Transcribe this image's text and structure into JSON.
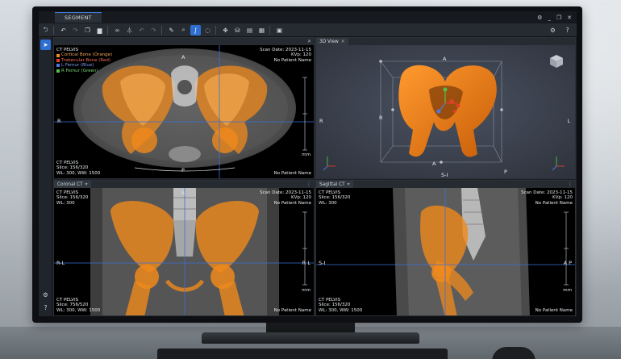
{
  "app": {
    "tab_label": "SEGMENT",
    "window_controls": [
      "⚙",
      "_",
      "❐",
      "✕"
    ]
  },
  "toolbar": {
    "icons": [
      "undo-icon",
      "undo-step-icon",
      "redo-step-icon",
      "copy-icon",
      "delete-icon",
      "link-icon",
      "filter-icon",
      "undo-dim-icon",
      "redo-dim-icon",
      "brush-icon",
      "zoom-icon",
      "draw-curve-icon",
      "lasso-icon",
      "move-icon",
      "threshold-icon",
      "grid-icon",
      "export-icon"
    ],
    "right_icons": [
      "gear-icon",
      "help-icon"
    ]
  },
  "viewports": {
    "axial": {
      "title": "",
      "top_left": [
        "CT PELVIS"
      ],
      "legend": [
        {
          "label": "Cortical Bone (Orange)",
          "color": "#f08a1c"
        },
        {
          "label": "Trabecular Bone (Red)",
          "color": "#e0402a"
        },
        {
          "label": "L Femur (Blue)",
          "color": "#4a78e8"
        },
        {
          "label": "R Femur (Green)",
          "color": "#4fc24f"
        }
      ],
      "top_right": [
        "Scan Date: 2023-11-15",
        "KVp: 120",
        "No Patient Name"
      ],
      "bottom_left": [
        "CT PELVIS",
        "Slice: 156/320",
        "WL: 300, WW: 1500"
      ],
      "bottom_right": [
        "No Patient Name"
      ],
      "orient_top": "A",
      "orient_left": "R",
      "orient_bottom": "P",
      "scale_unit": "mm"
    },
    "view3d": {
      "title": "3D View",
      "orient_top": "A",
      "orient_left": "R",
      "orient_right": "L",
      "orient_bottom": "A",
      "orient_bottom2": "S-I",
      "orient_bottom_right": "P"
    },
    "coronal": {
      "title": "Coronal CT",
      "top_left": [
        "CT PELVIS",
        "Slice: 156/320",
        "WL: 300"
      ],
      "top_right": [
        "Scan Date: 2023-11-15",
        "KVp: 120",
        "No Patient Name"
      ],
      "bottom_left": [
        "CT PELVIS",
        "Slice: 756/520",
        "WL: 300, WW: 1500"
      ],
      "bottom_right": [
        "No Patient Name"
      ],
      "orient_left": "R-L",
      "orient_right": "R L",
      "orient_top": "S",
      "scale_unit": "mm"
    },
    "sagittal": {
      "title": "Sagittal CT",
      "top_left": [
        "CT PELVIS",
        "Slice: 156/320",
        "WL: 300"
      ],
      "top_right": [
        "Scan Date: 2023-11-15",
        "KVp: 120",
        "No Patient Name"
      ],
      "bottom_left": [
        "CT PELVIS",
        "Slice: 156/320",
        "WL: 300, WW: 1500"
      ],
      "bottom_right": [
        "No Patient Name"
      ],
      "orient_left": "S-I",
      "orient_right": "A P",
      "scale_unit": "mm"
    }
  },
  "colors": {
    "accent": "#2f6fd1",
    "bone_orange": "#f08a1c",
    "crosshair": "#3b6fd8"
  }
}
